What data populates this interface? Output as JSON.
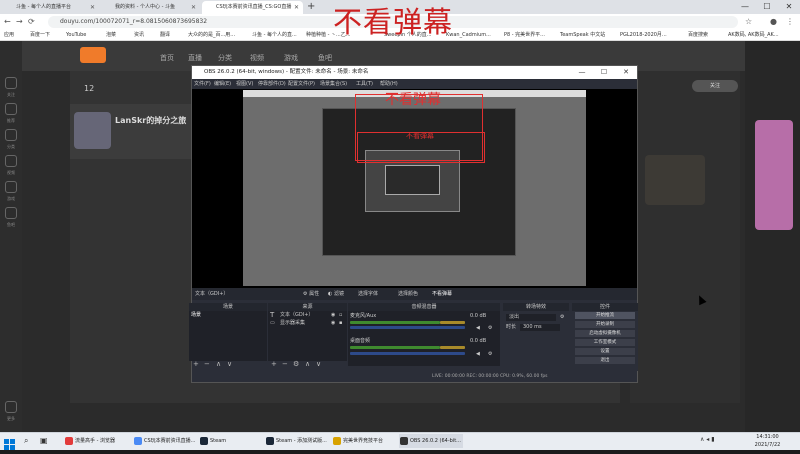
{
  "browser": {
    "tabs": [
      {
        "label": "斗鱼 - 每个人的直播平台",
        "fav": "#f07b2a",
        "active": false
      },
      {
        "label": "我的资料 - 个人中心 - 斗鱼",
        "fav": "#f07b2a",
        "active": false
      },
      {
        "label": "CS玩本赛前资讯直播_CS:GO直播",
        "fav": "#f07b2a",
        "active": true
      }
    ],
    "new_tab": "+",
    "url": "douyu.com/100072071_r=8.0815060873695832",
    "bookmarks": [
      "应用",
      "百度一下",
      "YouTube",
      "泡菜",
      "资讯",
      "翻译",
      "大众的的是_百...用...",
      "斗鱼 - 每个人的直...",
      "种植种植 - 丶...乙...",
      "Sweepin 个人的直...",
      "Kwan_Cadmium...",
      "P8 - 完美世界平...",
      "TeamSpeak 中文站",
      "PGL2018-2020月...",
      "百度搜索",
      "AK数码, AK数码_AK..."
    ],
    "window_controls": [
      "—",
      "☐",
      "✕"
    ]
  },
  "site": {
    "nav": [
      "首页",
      "直播",
      "分类",
      "视频",
      "游戏",
      "鱼吧"
    ],
    "left_nav": [
      "关注",
      "推荐",
      "分类",
      "视频",
      "游戏",
      "鱼吧",
      "更多"
    ],
    "streamer": "LanSkr的掉分之旅",
    "stat_count": "12",
    "follow_label": "关注",
    "overlay_text": "不看弹幕"
  },
  "obs": {
    "title": "OBS 26.0.2 (64-bit, windows) - 配置文件: 未命名 - 场景: 未命名",
    "menu": [
      "文件(F)",
      "编辑(E)",
      "视图(V)",
      "停靠部件(D)",
      "配置文件(P)",
      "场景集合(S)",
      "工具(T)",
      "帮助(H)"
    ],
    "preview_text_big": "不看弹幕",
    "preview_text_small": "不看弹幕",
    "toolbar": [
      "文本（GDI+）",
      "属性",
      "滤镜",
      "选择字体",
      "选择颜色",
      "不看弹幕"
    ],
    "docks": [
      "场景",
      "来源",
      "音频混音器",
      "转场特效",
      "控件"
    ],
    "scenes": [
      "场景"
    ],
    "sources": [
      "文本（GDI+）",
      "显示器采集"
    ],
    "mixer": [
      {
        "name": "麦克风/Aux",
        "db": "0.0 dB"
      },
      {
        "name": "桌面音频",
        "db": "0.0 dB"
      }
    ],
    "transition": {
      "type": "淡出",
      "duration_label": "时长",
      "duration": "300 ms"
    },
    "controls": [
      "开始推流",
      "开始录制",
      "启动虚拟摄像机",
      "工作室模式",
      "设置",
      "退出"
    ],
    "status": "LIVE: 00:00:00   REC: 00:00:00   CPU: 0.9%, 60.00 fps"
  },
  "taskbar": {
    "items": [
      {
        "label": "流量高手 - 浏览器",
        "color": "#e23b3b"
      },
      {
        "label": "CS玩本赛前资讯直播...",
        "color": "#4a8af4"
      },
      {
        "label": "Steam",
        "color": "#1b2838"
      },
      {
        "label": "Steam - 添加测试版...",
        "color": "#1b2838"
      },
      {
        "label": "完美世界竞技平台",
        "color": "#d8a200"
      },
      {
        "label": "OBS 26.0.2 (64-bit...",
        "color": "#333333"
      }
    ],
    "time": "14:31:00",
    "date": "2021/7/22"
  }
}
